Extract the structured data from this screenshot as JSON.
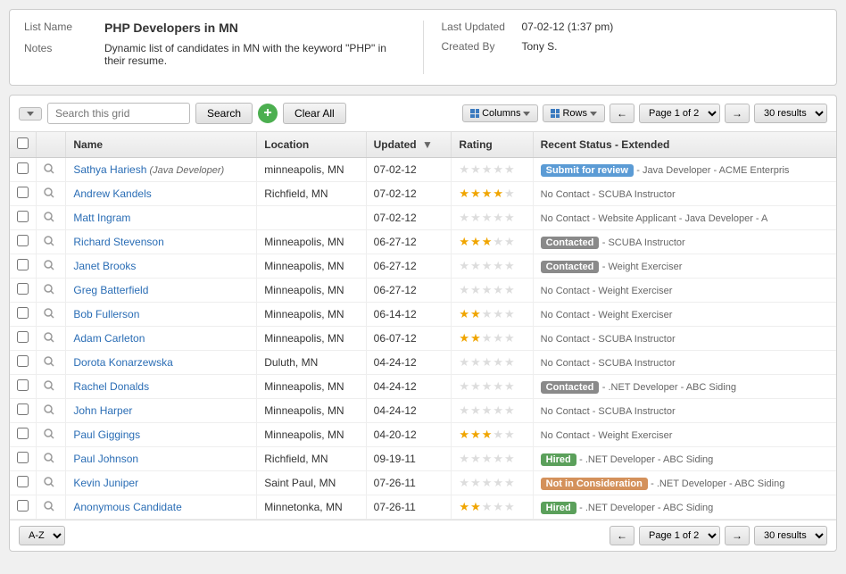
{
  "header": {
    "list_name_label": "List Name",
    "list_name_value": "PHP Developers in MN",
    "notes_label": "Notes",
    "notes_value": "Dynamic list of candidates in MN with the keyword \"PHP\" in their resume.",
    "last_updated_label": "Last Updated",
    "last_updated_value": "07-02-12 (1:37 pm)",
    "created_by_label": "Created By",
    "created_by_value": "Tony S."
  },
  "toolbar": {
    "filter_label": "",
    "search_placeholder": "Search this grid",
    "search_btn": "Search",
    "add_btn": "+",
    "clear_btn": "Clear All",
    "columns_btn": "Columns",
    "rows_btn": "Rows",
    "prev_btn": "←",
    "next_btn": "→",
    "page_label": "Page 1 of 2",
    "results_label": "30 results"
  },
  "columns": [
    {
      "key": "checkbox",
      "label": ""
    },
    {
      "key": "search",
      "label": ""
    },
    {
      "key": "name",
      "label": "Name"
    },
    {
      "key": "location",
      "label": "Location"
    },
    {
      "key": "updated",
      "label": "Updated"
    },
    {
      "key": "rating",
      "label": "Rating"
    },
    {
      "key": "recent_status",
      "label": "Recent Status - Extended"
    }
  ],
  "rows": [
    {
      "id": 1,
      "name": "Sathya Hariesh",
      "sub": "Java Developer",
      "location": "minneapolis, MN",
      "updated": "07-02-12",
      "stars": [
        0,
        0,
        0,
        0,
        0
      ],
      "status_badge": "submit",
      "status_badge_label": "Submit for review",
      "status_text": "- Java Developer - ACME Enterpris"
    },
    {
      "id": 2,
      "name": "Andrew Kandels",
      "sub": "",
      "location": "Richfield, MN",
      "updated": "07-02-12",
      "stars": [
        1,
        1,
        1,
        1,
        0
      ],
      "status_badge": "",
      "status_badge_label": "",
      "status_text": "No Contact  - SCUBA Instructor"
    },
    {
      "id": 3,
      "name": "Matt Ingram",
      "sub": "",
      "location": "",
      "updated": "07-02-12",
      "stars": [
        0,
        0,
        0,
        0,
        0
      ],
      "status_badge": "",
      "status_badge_label": "",
      "status_text": "No Contact - Website Applicant  - Java Developer - A"
    },
    {
      "id": 4,
      "name": "Richard Stevenson",
      "sub": "",
      "location": "Minneapolis, MN",
      "updated": "06-27-12",
      "stars": [
        1,
        1,
        1,
        0,
        0
      ],
      "status_badge": "contacted",
      "status_badge_label": "Contacted",
      "status_text": "- SCUBA Instructor"
    },
    {
      "id": 5,
      "name": "Janet Brooks",
      "sub": "",
      "location": "Minneapolis, MN",
      "updated": "06-27-12",
      "stars": [
        0,
        0,
        0,
        0,
        0
      ],
      "status_badge": "contacted",
      "status_badge_label": "Contacted",
      "status_text": "- Weight Exerciser"
    },
    {
      "id": 6,
      "name": "Greg Batterfield",
      "sub": "",
      "location": "Minneapolis, MN",
      "updated": "06-27-12",
      "stars": [
        0,
        0,
        0,
        0,
        0
      ],
      "status_badge": "",
      "status_badge_label": "",
      "status_text": "No Contact  - Weight Exerciser"
    },
    {
      "id": 7,
      "name": "Bob Fullerson",
      "sub": "",
      "location": "Minneapolis, MN",
      "updated": "06-14-12",
      "stars": [
        1,
        1,
        0,
        0,
        0
      ],
      "status_badge": "",
      "status_badge_label": "",
      "status_text": "No Contact  - Weight Exerciser"
    },
    {
      "id": 8,
      "name": "Adam Carleton",
      "sub": "",
      "location": "Minneapolis, MN",
      "updated": "06-07-12",
      "stars": [
        1,
        1,
        0,
        0,
        0
      ],
      "status_badge": "",
      "status_badge_label": "",
      "status_text": "No Contact  - SCUBA Instructor"
    },
    {
      "id": 9,
      "name": "Dorota Konarzewska",
      "sub": "",
      "location": "Duluth, MN",
      "updated": "04-24-12",
      "stars": [
        0,
        0,
        0,
        0,
        0
      ],
      "status_badge": "",
      "status_badge_label": "",
      "status_text": "No Contact  - SCUBA Instructor"
    },
    {
      "id": 10,
      "name": "Rachel Donalds",
      "sub": "",
      "location": "Minneapolis, MN",
      "updated": "04-24-12",
      "stars": [
        0,
        0,
        0,
        0,
        0
      ],
      "status_badge": "contacted",
      "status_badge_label": "Contacted",
      "status_text": "- .NET Developer - ABC Siding"
    },
    {
      "id": 11,
      "name": "John Harper",
      "sub": "",
      "location": "Minneapolis, MN",
      "updated": "04-24-12",
      "stars": [
        0,
        0,
        0,
        0,
        0
      ],
      "status_badge": "",
      "status_badge_label": "",
      "status_text": "No Contact  - SCUBA Instructor"
    },
    {
      "id": 12,
      "name": "Paul Giggings",
      "sub": "",
      "location": "Minneapolis, MN",
      "updated": "04-20-12",
      "stars": [
        1,
        1,
        1,
        0,
        0
      ],
      "status_badge": "",
      "status_badge_label": "",
      "status_text": "No Contact  - Weight Exerciser"
    },
    {
      "id": 13,
      "name": "Paul Johnson",
      "sub": "",
      "location": "Richfield, MN",
      "updated": "09-19-11",
      "stars": [
        0,
        0,
        0,
        0,
        0
      ],
      "status_badge": "hired",
      "status_badge_label": "Hired",
      "status_text": "- .NET Developer - ABC Siding"
    },
    {
      "id": 14,
      "name": "Kevin Juniper",
      "sub": "",
      "location": "Saint Paul, MN",
      "updated": "07-26-11",
      "stars": [
        0,
        0,
        0,
        0,
        0
      ],
      "status_badge": "not-considered",
      "status_badge_label": "Not in Consideration",
      "status_text": "- .NET Developer - ABC Siding"
    },
    {
      "id": 15,
      "name": "Anonymous Candidate",
      "sub": "",
      "location": "Minnetonka, MN",
      "updated": "07-26-11",
      "stars": [
        1,
        1,
        0,
        0,
        0
      ],
      "status_badge": "hired",
      "status_badge_label": "Hired",
      "status_text": "- .NET Developer - ABC Siding"
    }
  ],
  "bottom": {
    "sort_label": "A-Z",
    "prev_btn": "←",
    "next_btn": "→",
    "page_label": "Page 1 of 2",
    "results_label": "30 results"
  }
}
